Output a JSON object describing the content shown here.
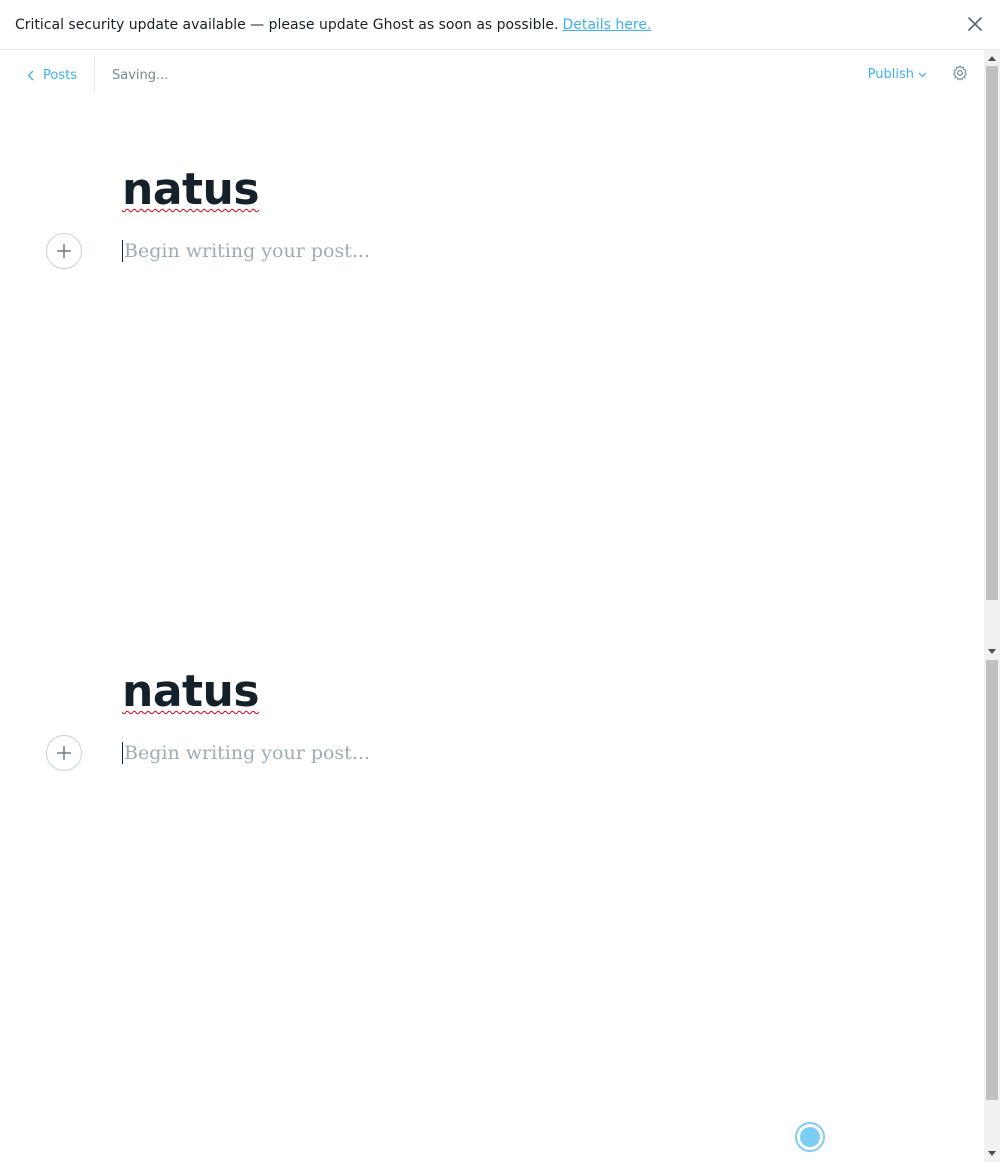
{
  "banner": {
    "message": "Critical security update available — please update Ghost as soon as possible.",
    "link_label": "Details here."
  },
  "toolbar": {
    "back_label": "Posts",
    "status": "Saving...",
    "publish_label": "Publish"
  },
  "editor": {
    "title": "natus",
    "placeholder": "Begin writing your post..."
  },
  "colors": {
    "accent": "#3eb0ef",
    "text": "#15212a",
    "muted": "#738a94",
    "placeholder": "#9baeb8",
    "spellcheck": "#d0021b"
  },
  "icons": [
    "close-icon",
    "chevron-left-icon",
    "chevron-down-icon",
    "gear-icon",
    "plus-icon",
    "loading-icon"
  ]
}
